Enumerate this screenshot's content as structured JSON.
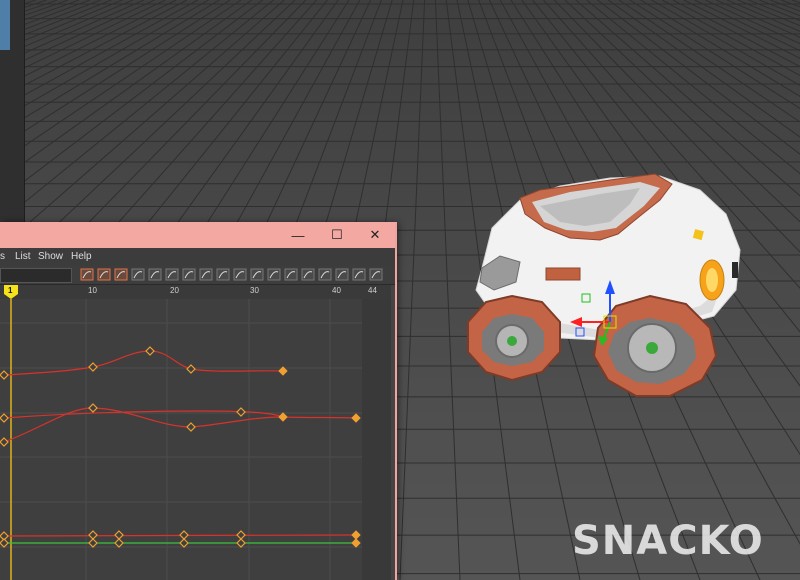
{
  "graph_editor": {
    "window_controls": {
      "minimize": "—",
      "maximize": "☐",
      "close": "✕"
    },
    "menu": [
      "s",
      "List",
      "Show",
      "Help"
    ],
    "current_frame": "1",
    "frame_ticks": [
      "10",
      "20",
      "30",
      "40",
      "44"
    ]
  },
  "toolbar_icons": [
    "frame-all-icon",
    "frame-selection-icon",
    "frame-playback-icon",
    "auto-tangent-icon",
    "spline-tangent-icon",
    "clamped-tangent-icon",
    "linear-tangent-icon",
    "flat-tangent-icon",
    "step-tangent-icon",
    "plateau-tangent-icon",
    "break-tangent-icon",
    "unify-tangent-icon",
    "free-weight-icon",
    "lock-weight-icon",
    "tangent-icon",
    "move-key-icon",
    "dope-sheet-icon",
    "camera-icon"
  ],
  "watermark": "SNACKO"
}
